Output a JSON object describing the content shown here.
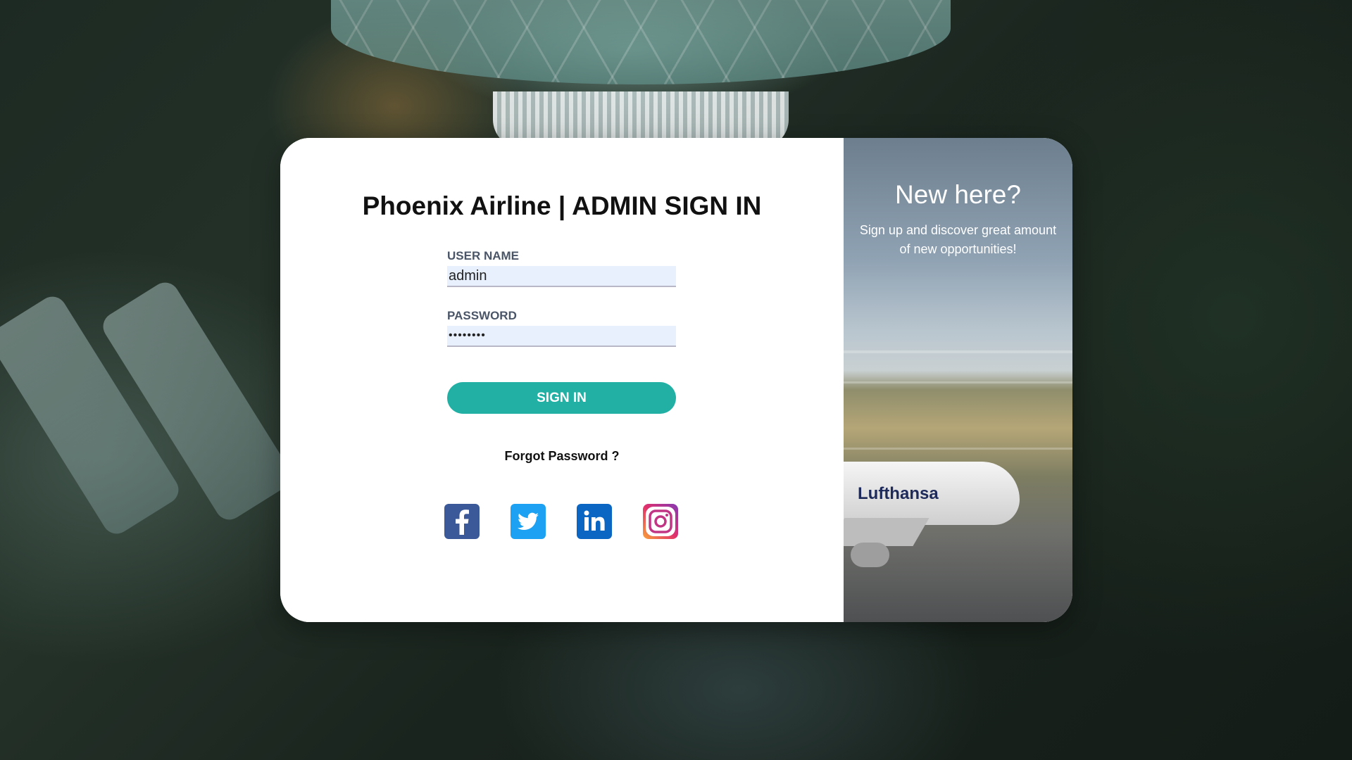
{
  "login": {
    "title": "Phoenix Airline | ADMIN SIGN IN",
    "username_label": "USER NAME",
    "username_value": "admin",
    "password_label": "PASSWORD",
    "password_value": "••••••••",
    "signin_label": "SIGN IN",
    "forgot_label": "Forgot Password ?"
  },
  "social": [
    {
      "name": "facebook",
      "icon": "facebook-icon",
      "color": "#3b5998"
    },
    {
      "name": "twitter",
      "icon": "twitter-icon",
      "color": "#1da1f2"
    },
    {
      "name": "linkedin",
      "icon": "linkedin-icon",
      "color": "#0a66c2"
    },
    {
      "name": "instagram",
      "icon": "instagram-icon",
      "color": "#e1306c"
    }
  ],
  "promo": {
    "title": "New here?",
    "text": "Sign up and discover great amount of new opportunities!",
    "plane_livery": "Lufthansa"
  },
  "colors": {
    "accent": "#22b0a4",
    "input_bg": "#e8f0fe"
  }
}
